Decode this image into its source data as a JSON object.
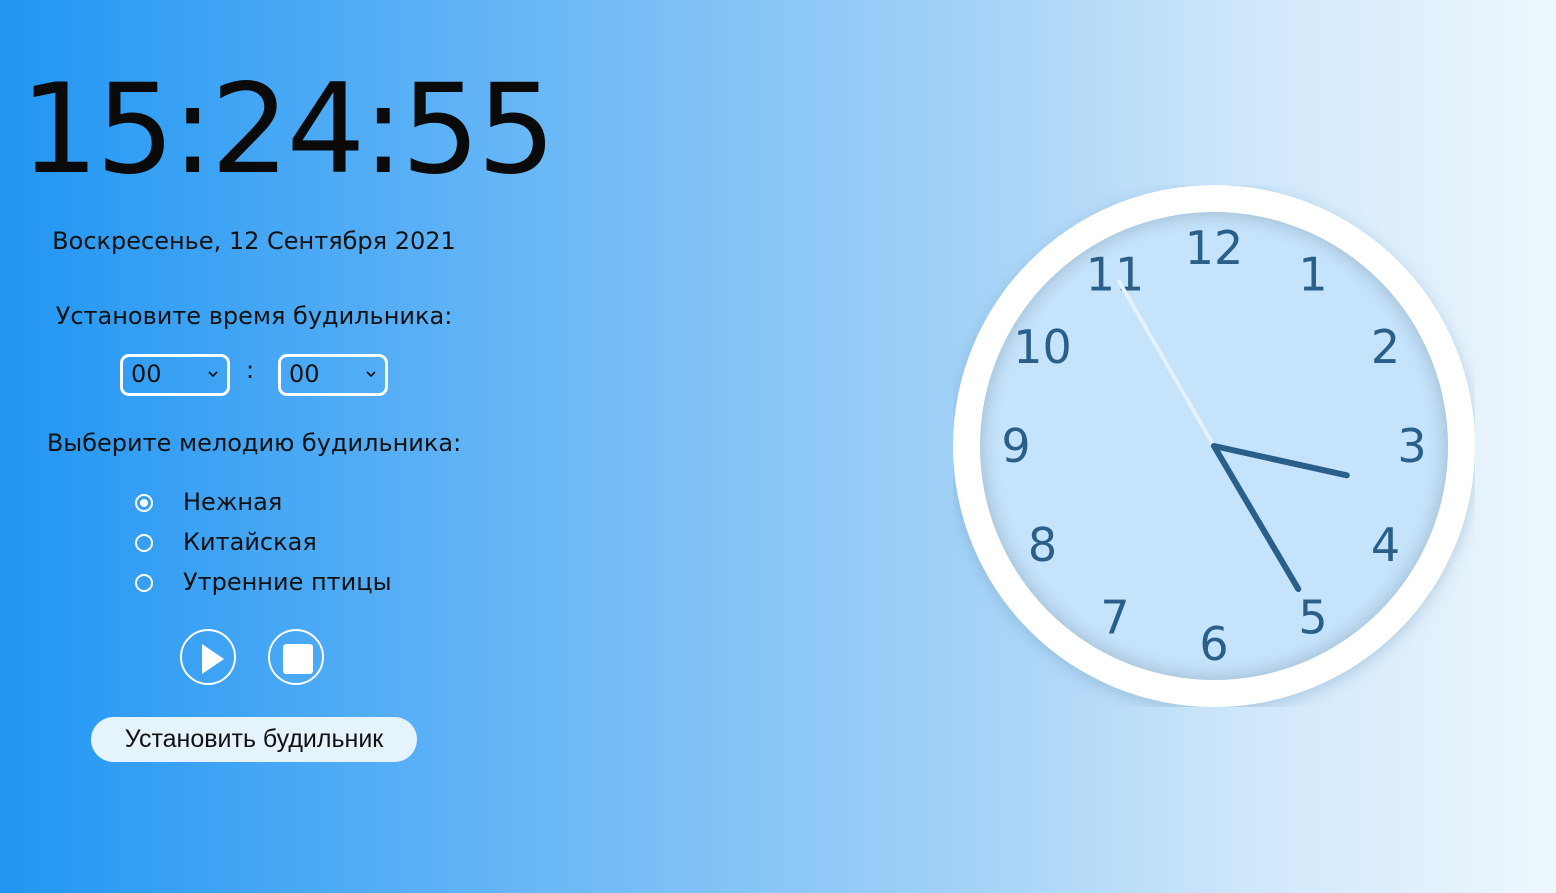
{
  "clock": {
    "time": "15:24:55",
    "date": "Воскресенье, 12 Сентября 2021",
    "hour": 15,
    "minute": 24,
    "second": 55
  },
  "alarm": {
    "label": "Установите время будильника:",
    "hour_value": "00",
    "minute_value": "00",
    "separator": ":"
  },
  "melody": {
    "label": "Выберите мелодию будильника:",
    "options": [
      {
        "name": "Нежная",
        "checked": true
      },
      {
        "name": "Китайская",
        "checked": false
      },
      {
        "name": "Утренние птицы",
        "checked": false
      }
    ]
  },
  "controls": {
    "play_icon": "play-icon",
    "stop_icon": "stop-icon",
    "set_alarm_label": "Установить будильник"
  },
  "analog": {
    "numbers": [
      "12",
      "1",
      "2",
      "3",
      "4",
      "5",
      "6",
      "7",
      "8",
      "9",
      "10",
      "11"
    ],
    "colors": {
      "face": "#c5e3fb",
      "rim": "#ffffff",
      "numerals": "#2a5f8a",
      "hands": "#2a5f8a",
      "second_hand": "#e3f2fd"
    }
  }
}
